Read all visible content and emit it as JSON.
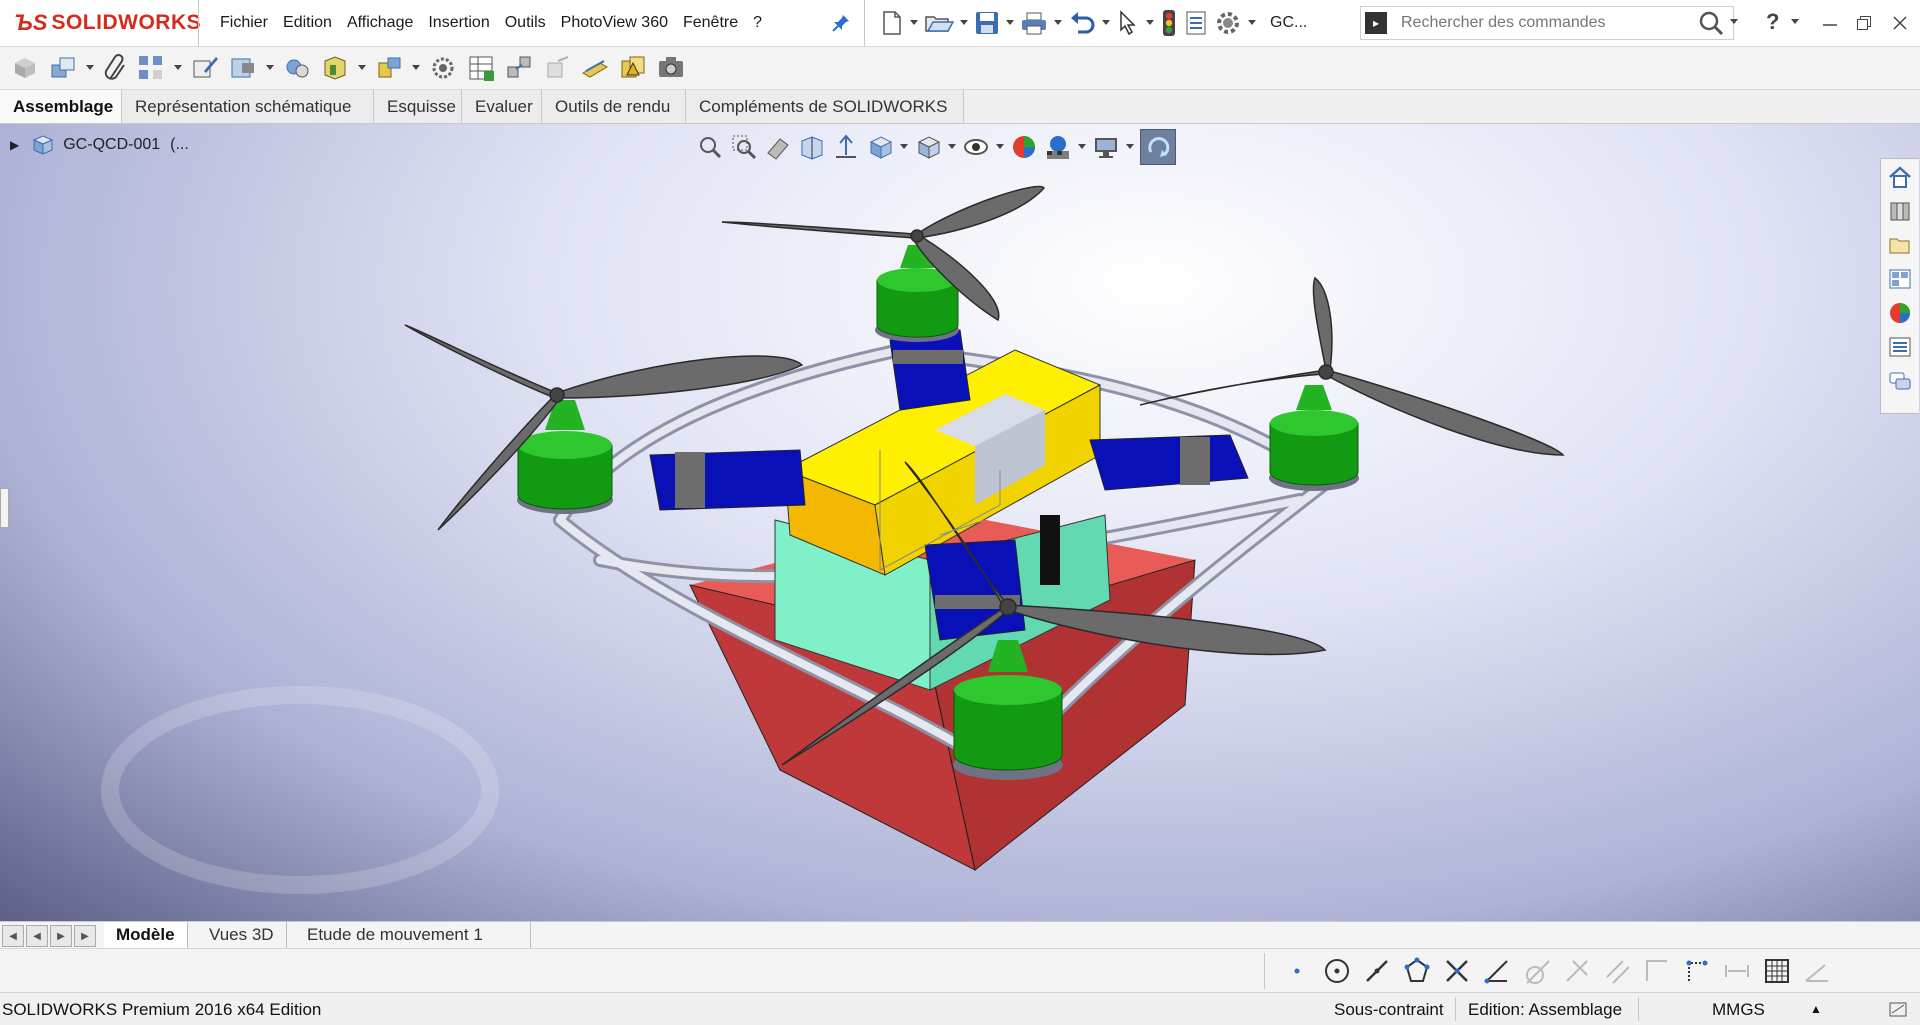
{
  "app": {
    "brand": "SOLIDWORKS",
    "colors": {
      "brand": "#d52b1e",
      "accent": "#1f6fc1"
    }
  },
  "menu": {
    "items": [
      "Fichier",
      "Edition",
      "Affichage",
      "Insertion",
      "Outils",
      "PhotoView 360",
      "Fenêtre",
      "?"
    ]
  },
  "quick_access": {
    "doc_short_name": "GC...",
    "search_placeholder": "Rechercher des commandes",
    "help_label": "?"
  },
  "command_tabs": [
    "Assemblage",
    "Représentation schématique",
    "Esquisse",
    "Evaluer",
    "Outils de rendu",
    "Compléments de SOLIDWORKS"
  ],
  "feature_tree": {
    "root_label": "GC-QCD-001",
    "root_suffix": "(..."
  },
  "heads_up_icons": [
    "zoom-to-fit-icon",
    "zoom-area-icon",
    "previous-view-icon",
    "section-view-icon",
    "dynamic-annotation-icon",
    "view-orientation-icon",
    "display-style-icon",
    "hide-show-icon",
    "edit-appearance-icon",
    "apply-scene-icon",
    "view-settings-icon",
    "rotate-view-icon"
  ],
  "task_pane_icons": [
    "home-icon",
    "design-library-icon",
    "file-explorer-icon",
    "view-palette-icon",
    "appearances-icon",
    "custom-properties-icon",
    "forum-icon"
  ],
  "bottom_tabs": [
    "Modèle",
    "Vues 3D",
    "Etude de mouvement 1"
  ],
  "status": {
    "edition_text": "SOLIDWORKS Premium 2016 x64 Edition",
    "constraint": "Sous-contraint",
    "mode": "Edition: Assemblage",
    "units": "MMGS"
  }
}
